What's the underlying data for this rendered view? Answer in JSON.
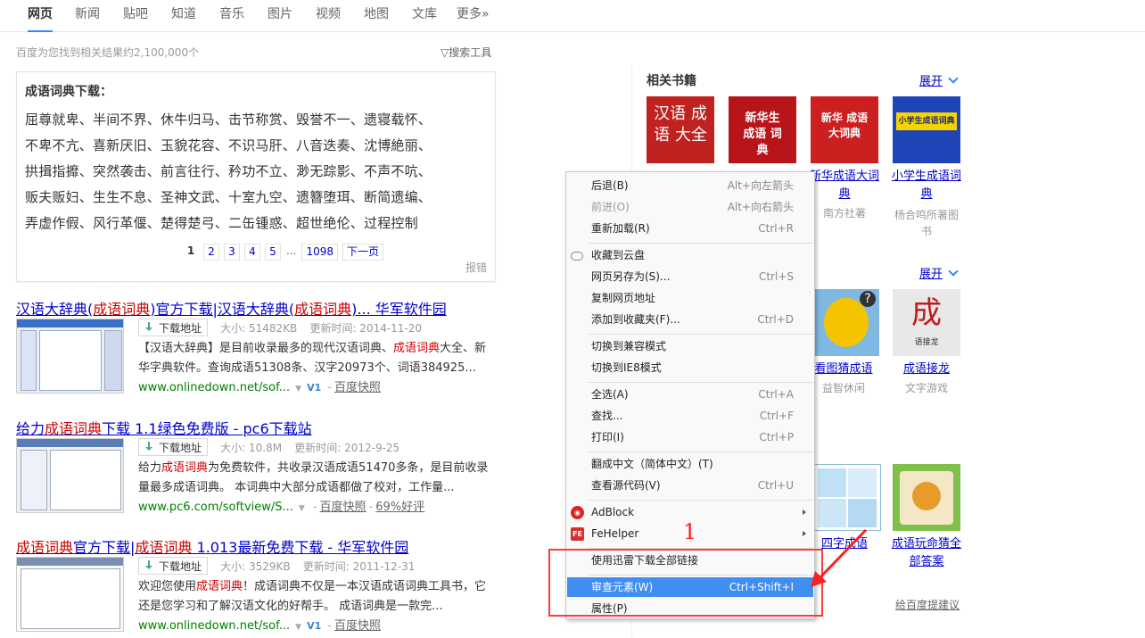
{
  "tabs": [
    "网页",
    "新闻",
    "贴吧",
    "知道",
    "音乐",
    "图片",
    "视频",
    "地图",
    "文库",
    "更多»"
  ],
  "result_count": "百度为您找到相关结果约2,100,000个",
  "search_tools": "搜索工具",
  "idiom_box": {
    "title": "成语词典下载：",
    "rows": [
      "屈尊就卑、半间不界、休牛归马、击节称赏、毁誉不一、遗寝载怀、",
      "不卑不亢、喜新厌旧、玉貌花容、不识马肝、八音迭奏、沈博絶丽、",
      "拱揖指攠、突然袭击、前言往行、矜功不立、渺无踪影、不声不吭、",
      "贩夫贩妇、生生不息、圣神文武、十室九空、遗簪堕珥、断简遗编、",
      "弄虚作假、风行革偃、楚得楚弓、二缶锺惑、超世绝伦、过程控制"
    ],
    "pager": [
      "1",
      "2",
      "3",
      "4",
      "5",
      "...",
      "1098",
      "下一页"
    ],
    "report": "报错"
  },
  "results": [
    {
      "title_pre": "汉语大辞典(",
      "title_em1": "成语词典",
      "title_mid": ")官方下载|汉语大辞典(",
      "title_em2": "成语词典",
      "title_post": ")... 华军软件园",
      "download": "下载地址",
      "size": "大小: 51482KB",
      "updated": "更新时间: 2014-11-20",
      "snippet_pre": "【汉语大辞典】是目前收录最多的现代汉语词典、",
      "snippet_em": "成语词典",
      "snippet_post": "大全、新华字典软件。查询成语51308条、汉字20973个、词语384925...",
      "url": "www.onlinedown.net/sof...",
      "badge": "V1",
      "snapshot": "百度快照",
      "rating": ""
    },
    {
      "title_pre": "给力",
      "title_em1": "成语词典",
      "title_mid": "下载 1.1绿色免费版 ",
      "title_em2": "",
      "title_post": " - pc6下载站",
      "download": "下载地址",
      "size": "大小: 10.8M",
      "updated": "更新时间: 2012-9-25",
      "snippet_pre": "给力",
      "snippet_em": "成语词典",
      "snippet_post": "为免费软件，共收录汉语成语51470多条，是目前收录量最多成语词典。 本词典中大部分成语都做了校对，工作量...",
      "url": "www.pc6.com/softview/S...",
      "badge": "",
      "snapshot": "百度快照",
      "rating": "69%好评"
    },
    {
      "title_pre": "",
      "title_em1": "成语词典",
      "title_mid": "官方下载|",
      "title_em2": "成语词典",
      "title_post": " 1.013最新免费下载 - 华军软件园",
      "download": "下载地址",
      "size": "大小: 3529KB",
      "updated": "更新时间: 2011-12-31",
      "snippet_pre": "欢迎您使用",
      "snippet_em": "成语词典",
      "snippet_post": "！成语词典不仅是一本汉语成语词典工具书，它还是您学习和了解汉语文化的好帮手。 成语词典是一款完...",
      "url": "www.onlinedown.net/sof...",
      "badge": "V1",
      "snapshot": "百度快照",
      "rating": ""
    }
  ],
  "right": {
    "books_title": "相关书籍",
    "expand": "展开",
    "books": [
      {
        "cover": "汉语 成语 大全",
        "color": "#c0231f",
        "title": "",
        "author": ""
      },
      {
        "cover": "新华生 成语 词典",
        "color": "#b8151a",
        "title": "",
        "author": ""
      },
      {
        "cover": "新华 成语大词典",
        "color": "#cc2020",
        "title": "新华成语大词典",
        "author": "南方社著"
      },
      {
        "cover": "小学生成语词典",
        "color": "#1e44b8",
        "title": "小学生成语词典",
        "author": "杨合鸣所著图书"
      }
    ],
    "games": [
      {
        "title": "看图猜成语",
        "sub": "益智休闲"
      },
      {
        "title": "成语接龙",
        "sub": "文字游戏"
      }
    ],
    "apps": [
      {
        "title": "四字成语"
      },
      {
        "title": "成语玩命猜全部答案"
      }
    ],
    "feedback": "给百度提建议"
  },
  "context_menu": {
    "items": [
      {
        "label": "后退(B)",
        "shortcut": "Alt+向左箭头",
        "disabled": false
      },
      {
        "label": "前进(O)",
        "shortcut": "Alt+向右箭头",
        "disabled": true
      },
      {
        "label": "重新加载(R)",
        "shortcut": "Ctrl+R",
        "disabled": false
      },
      {
        "label": "收藏到云盘",
        "shortcut": "",
        "disabled": false
      },
      {
        "label": "网页另存为(S)...",
        "shortcut": "Ctrl+S",
        "disabled": false
      },
      {
        "label": "复制网页地址",
        "shortcut": "",
        "disabled": false
      },
      {
        "label": "添加到收藏夹(F)...",
        "shortcut": "Ctrl+D",
        "disabled": false
      },
      {
        "label": "切换到兼容模式",
        "shortcut": "",
        "disabled": false
      },
      {
        "label": "切换到IE8模式",
        "shortcut": "",
        "disabled": false
      },
      {
        "label": "全选(A)",
        "shortcut": "Ctrl+A",
        "disabled": false
      },
      {
        "label": "查找...",
        "shortcut": "Ctrl+F",
        "disabled": false
      },
      {
        "label": "打印(I)",
        "shortcut": "Ctrl+P",
        "disabled": false
      },
      {
        "label": "翻成中文（简体中文）(T)",
        "shortcut": "",
        "disabled": false
      },
      {
        "label": "查看源代码(V)",
        "shortcut": "Ctrl+U",
        "disabled": false
      },
      {
        "label": "AdBlock",
        "shortcut": "",
        "disabled": false
      },
      {
        "label": "FeHelper",
        "shortcut": "",
        "disabled": false
      },
      {
        "label": "使用迅雷下载全部链接",
        "shortcut": "",
        "disabled": false
      },
      {
        "label": "审查元素(W)",
        "shortcut": "Ctrl+Shift+I",
        "disabled": false
      },
      {
        "label": "属性(P)",
        "shortcut": "",
        "disabled": false
      }
    ]
  },
  "annotation": {
    "number": "1",
    "color": "#ff3b3b"
  },
  "colors": {
    "link": "#0000cc",
    "highlight": "#cc0000",
    "url": "#008000",
    "menu_highlight": "#3f8ef0"
  }
}
